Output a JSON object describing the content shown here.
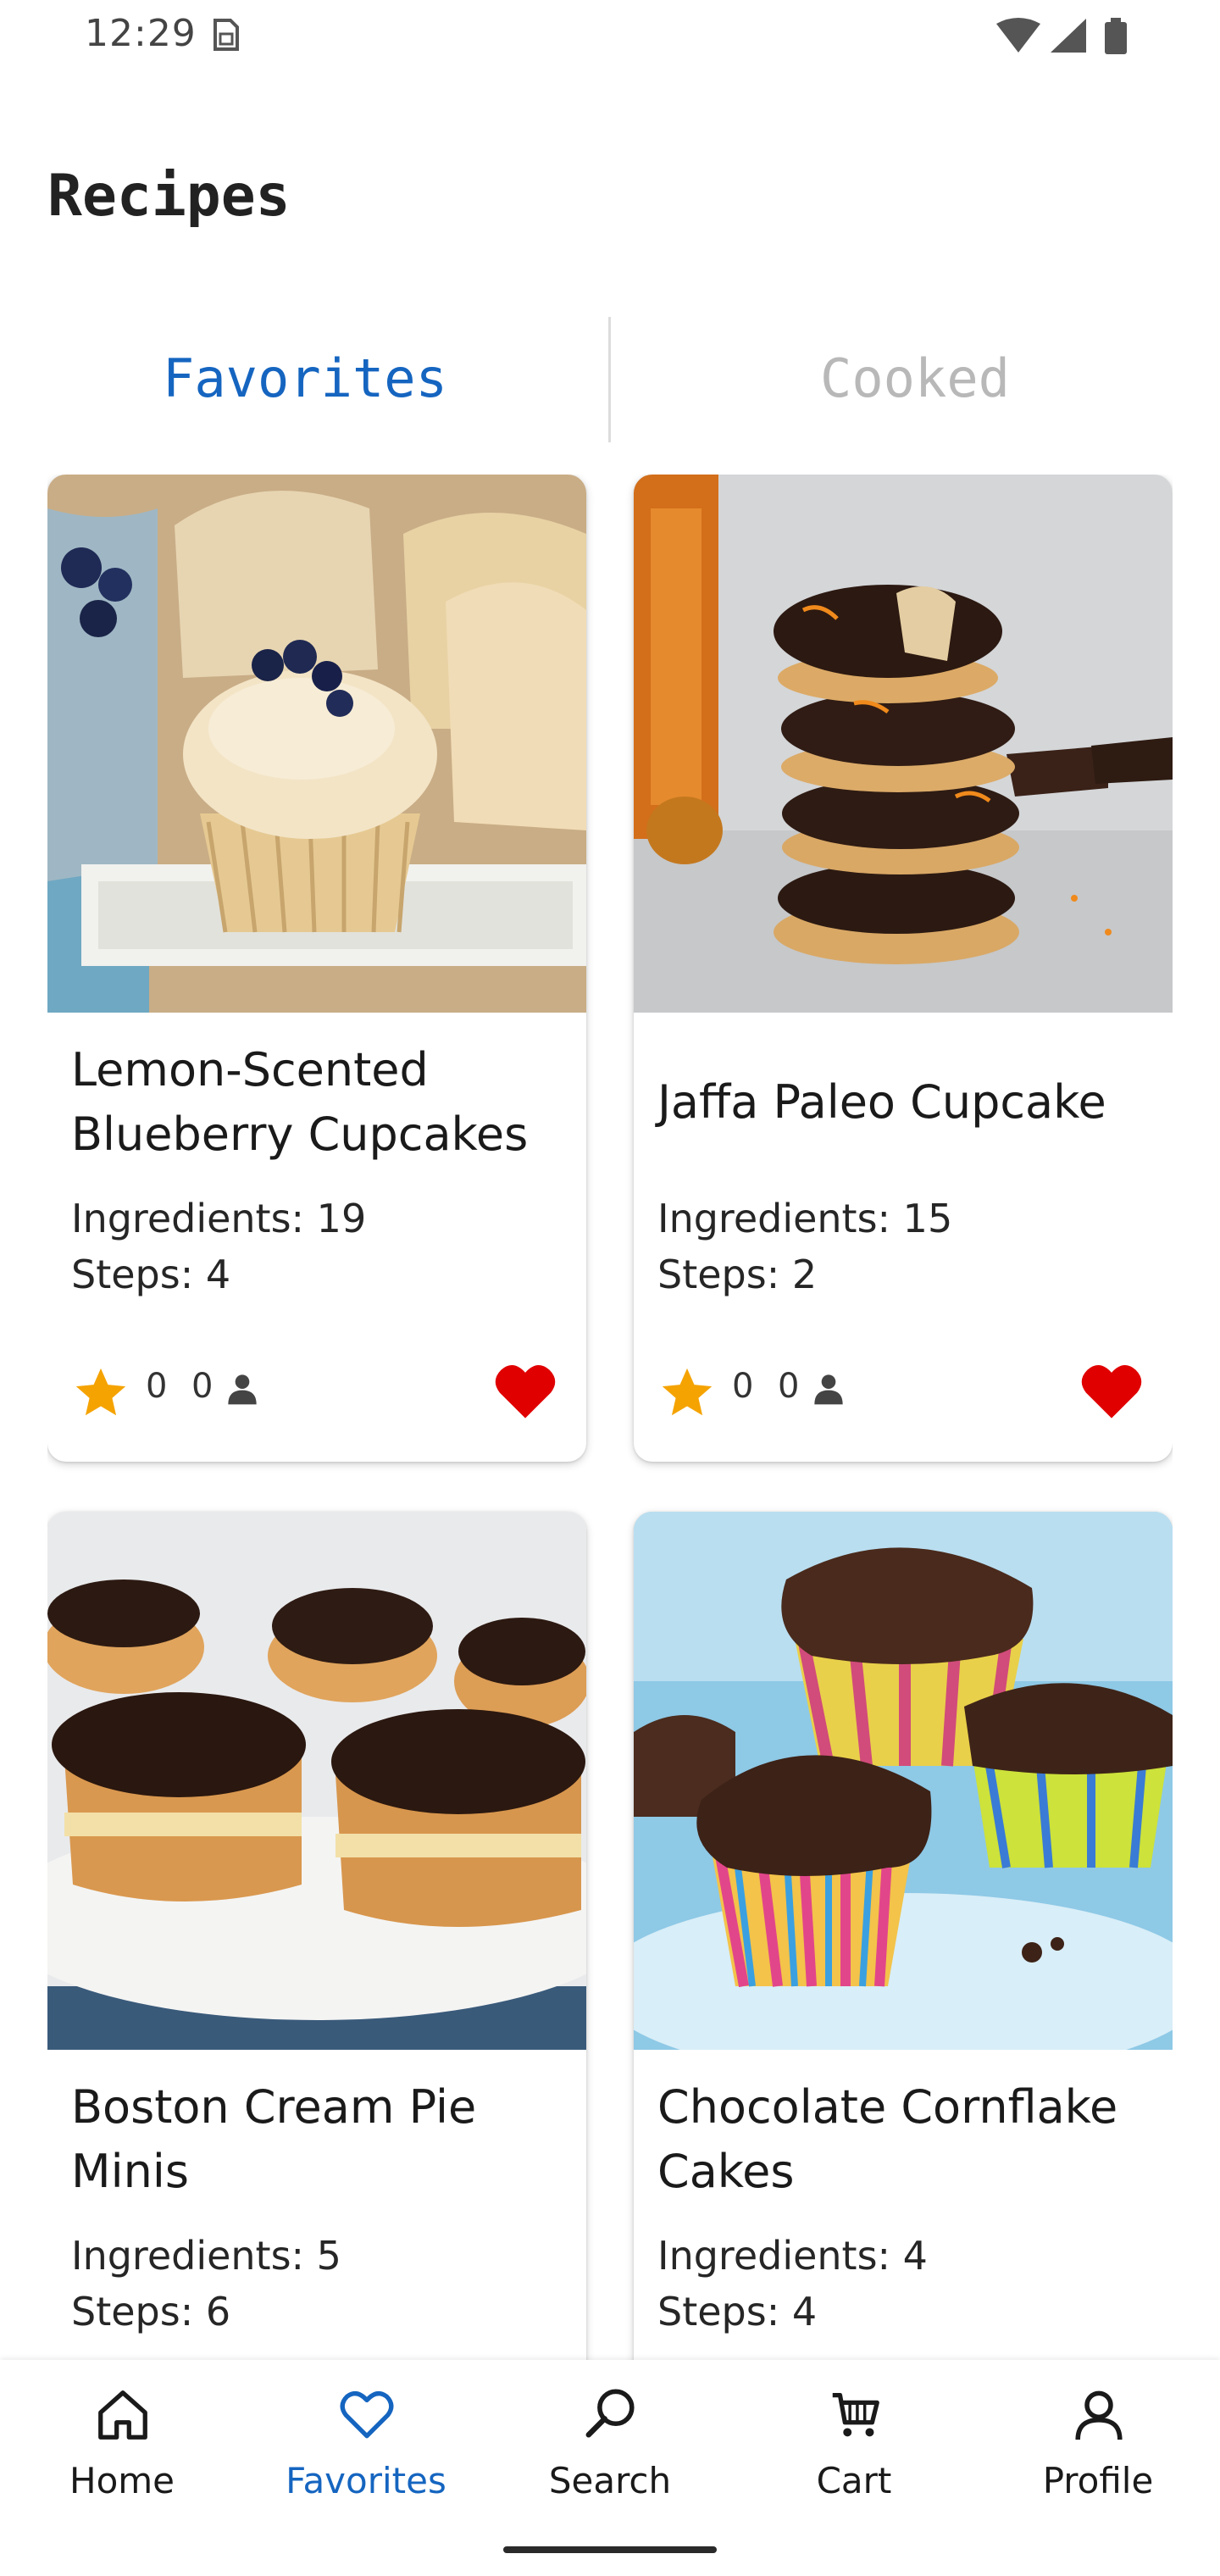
{
  "status_bar": {
    "time": "12:29",
    "sim_icon": "sim-card-icon",
    "icons": [
      "wifi-icon",
      "signal-icon",
      "battery-icon"
    ]
  },
  "page": {
    "title": "Recipes"
  },
  "tabs": [
    {
      "label": "Favorites",
      "active": true
    },
    {
      "label": "Cooked",
      "active": false
    }
  ],
  "recipes": [
    {
      "title": "Lemon-Scented Blueberry Cupcakes",
      "ingredients": "Ingredients: 19",
      "steps": "Steps: 4",
      "rating": "0",
      "cooked": "0",
      "favorite": true
    },
    {
      "title": "Jaffa Paleo Cupcake",
      "ingredients": "Ingredients: 15",
      "steps": "Steps: 2",
      "rating": "0",
      "cooked": "0",
      "favorite": true
    },
    {
      "title": "Boston Cream Pie Minis",
      "ingredients": "Ingredients: 5",
      "steps": "Steps: 6"
    },
    {
      "title": "Chocolate Cornflake Cakes",
      "ingredients": "Ingredients: 4",
      "steps": "Steps: 4"
    }
  ],
  "nav": {
    "items": [
      {
        "label": "Home",
        "icon": "home-icon"
      },
      {
        "label": "Favorites",
        "icon": "heart-icon",
        "active": true
      },
      {
        "label": "Search",
        "icon": "search-icon"
      },
      {
        "label": "Cart",
        "icon": "cart-icon"
      },
      {
        "label": "Profile",
        "icon": "profile-icon"
      }
    ]
  },
  "colors": {
    "accent": "#1565c0",
    "inactive_tab": "#b8b8b8",
    "heart": "#e00000",
    "star": "#f5a300"
  }
}
